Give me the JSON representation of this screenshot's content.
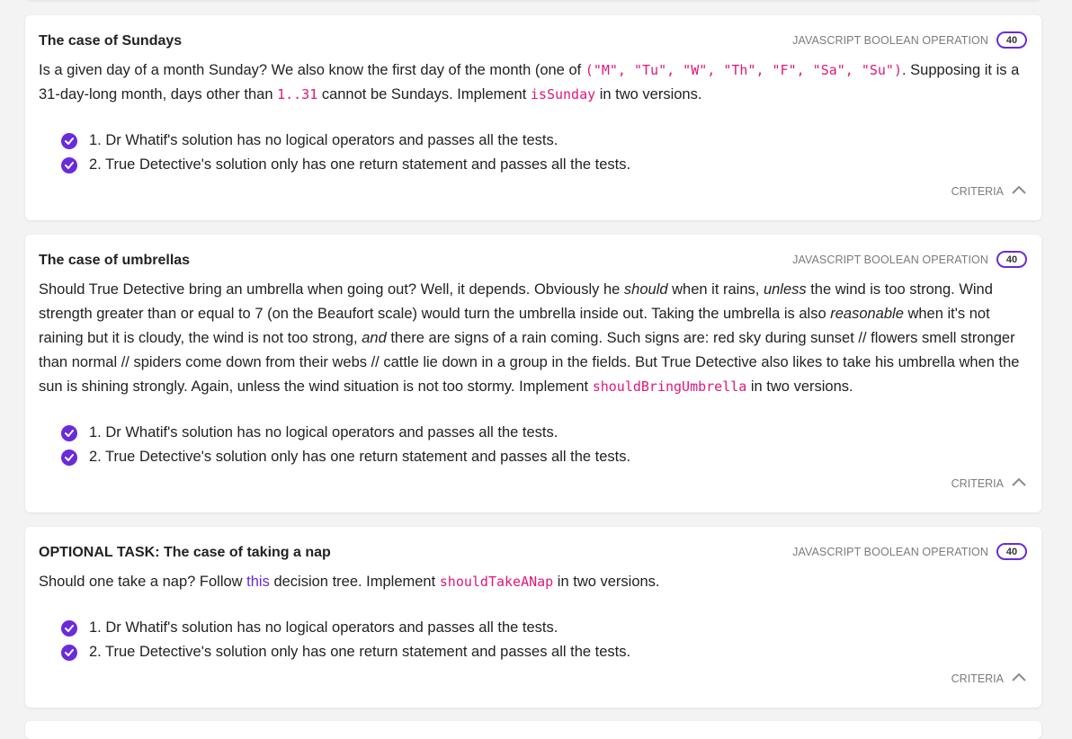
{
  "category_label": "JAVASCRIPT BOOLEAN OPERATION",
  "criteria_label": "CRITERIA",
  "accent_color": "#6a2bd9",
  "code_color": "#e0177a",
  "icons": {
    "check": "check-circle-icon",
    "toggle": "chevron-up-icon"
  },
  "tasks": [
    {
      "title": "The case of Sundays",
      "points": "40",
      "desc": {
        "t1": "Is a given day of a month Sunday? We also know the first day of the month (one of ",
        "code1": "(\"M\", \"Tu\", \"W\", \"Th\", \"F\", \"Sa\", \"Su\")",
        "t2": ". Supposing it is a 31-day-long month, days other than ",
        "code2": "1..31",
        "t3": " cannot be Sundays. Implement ",
        "code3": "isSunday",
        "t4": " in two versions."
      },
      "criteria": [
        "1. Dr Whatif's solution has no logical operators and passes all the tests.",
        "2. True Detective's solution only has one return statement and passes all the tests."
      ]
    },
    {
      "title": "The case of umbrellas",
      "points": "40",
      "desc": {
        "t1": "Should True Detective bring an umbrella when going out? Well, it depends. Obviously he ",
        "em1": "should",
        "t2": " when it rains, ",
        "em2": "unless",
        "t3": " the wind is too strong. Wind strength greater than or equal to 7 (on the Beaufort scale) would turn the umbrella inside out. Taking the umbrella is also ",
        "em3": "reasonable",
        "t4": " when it's not raining but it is cloudy, the wind is not too strong, ",
        "em4": "and",
        "t5": " there are signs of a rain coming. Such signs are: red sky during sunset // flowers smell stronger than normal // spiders come down from their webs // cattle lie down in a group in the fields. But True Detective also likes to take his umbrella when the sun is shining strongly. Again, unless the wind situation is not too stormy. Implement ",
        "code1": "shouldBringUmbrella",
        "t6": " in two versions."
      },
      "criteria": [
        "1. Dr Whatif's solution has no logical operators and passes all the tests.",
        "2. True Detective's solution only has one return statement and passes all the tests."
      ]
    },
    {
      "title_prefix": "OPTIONAL TASK:",
      "title": " The case of taking a nap",
      "points": "40",
      "desc": {
        "t1": "Should one take a nap? Follow ",
        "link": "this",
        "t2": " decision tree. Implement ",
        "code1": "shouldTakeANap",
        "t3": " in two versions."
      },
      "criteria": [
        "1. Dr Whatif's solution has no logical operators and passes all the tests.",
        "2. True Detective's solution only has one return statement and passes all the tests."
      ]
    }
  ]
}
